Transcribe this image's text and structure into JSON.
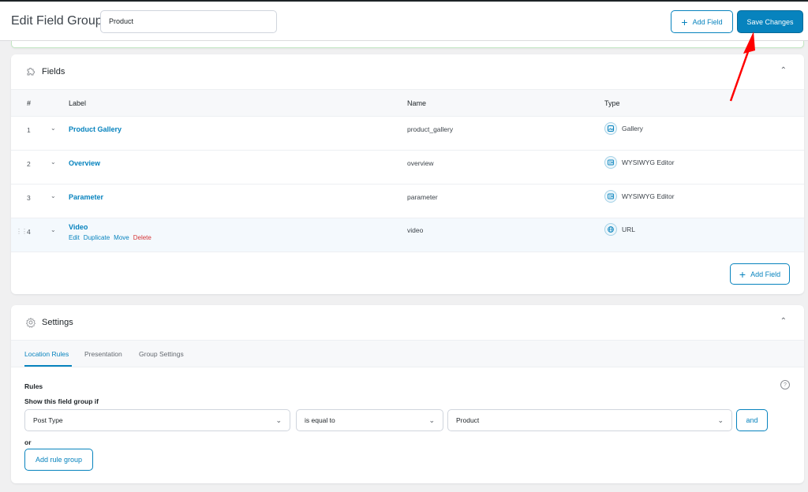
{
  "header": {
    "title": "Edit Field Group",
    "group_title_value": "Product",
    "add_field_label": "Add Field",
    "save_label": "Save Changes"
  },
  "fields_panel": {
    "title": "Fields",
    "columns": {
      "num": "#",
      "label": "Label",
      "name": "Name",
      "type": "Type"
    },
    "rows": [
      {
        "num": "1",
        "label": "Product Gallery",
        "name": "product_gallery",
        "type": "Gallery",
        "type_icon": "gallery-icon"
      },
      {
        "num": "2",
        "label": "Overview",
        "name": "overview",
        "type": "WYSIWYG Editor",
        "type_icon": "wysiwyg-icon"
      },
      {
        "num": "3",
        "label": "Parameter",
        "name": "parameter",
        "type": "WYSIWYG Editor",
        "type_icon": "wysiwyg-icon"
      },
      {
        "num": "4",
        "label": "Video",
        "name": "video",
        "type": "URL",
        "type_icon": "globe-icon",
        "actions": {
          "edit": "Edit",
          "duplicate": "Duplicate",
          "move": "Move",
          "delete": "Delete"
        }
      }
    ],
    "add_field_label": "Add Field"
  },
  "settings_panel": {
    "title": "Settings",
    "tabs": [
      "Location Rules",
      "Presentation",
      "Group Settings"
    ],
    "active_tab": "Location Rules",
    "rules_label": "Rules",
    "show_if_label": "Show this field group if",
    "rule": {
      "param": "Post Type",
      "operator": "is equal to",
      "value": "Product"
    },
    "and_label": "and",
    "or_label": "or",
    "add_rule_group_label": "Add rule group",
    "help_symbol": "?"
  },
  "colors": {
    "accent": "#0783be",
    "delete": "#d63638",
    "annotation_arrow": "#ff0000"
  }
}
